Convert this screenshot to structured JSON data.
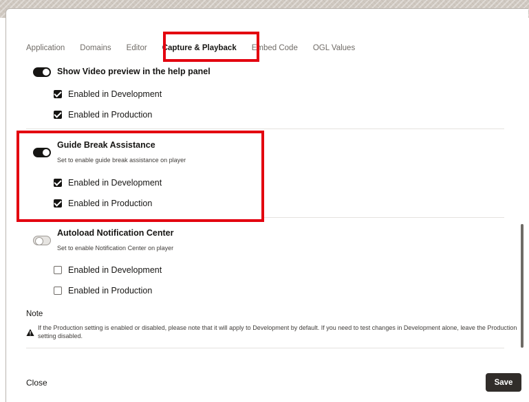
{
  "tabs": [
    {
      "label": "Application"
    },
    {
      "label": "Domains"
    },
    {
      "label": "Editor"
    },
    {
      "label": "Capture & Playback",
      "active": true
    },
    {
      "label": "Embed Code"
    },
    {
      "label": "OGL Values"
    }
  ],
  "settings": {
    "video_preview": {
      "title": "Show Video preview in the help panel",
      "enabled": true,
      "dev_label": "Enabled in Development",
      "dev_checked": true,
      "prod_label": "Enabled in Production",
      "prod_checked": true
    },
    "guide_break": {
      "title": "Guide Break Assistance",
      "description": "Set to enable guide break assistance on player",
      "enabled": true,
      "dev_label": "Enabled in Development",
      "dev_checked": true,
      "prod_label": "Enabled in Production",
      "prod_checked": true
    },
    "autoload_notification": {
      "title": "Autoload Notification Center",
      "description": "Set to enable Notification Center on player",
      "enabled": false,
      "dev_label": "Enabled in Development",
      "dev_checked": false,
      "prod_label": "Enabled in Production",
      "prod_checked": false
    }
  },
  "note": {
    "title": "Note",
    "text": "If the Production setting is enabled or disabled, please note that it will apply to Development by default. If you need to test changes in Development alone, leave the Production setting disabled."
  },
  "footer": {
    "close_label": "Close",
    "save_label": "Save"
  },
  "icons": {
    "warning": "warning-icon"
  },
  "colors": {
    "highlight": "#e3000f",
    "primary_button": "#312d2a",
    "toggle_on": "#161513"
  }
}
